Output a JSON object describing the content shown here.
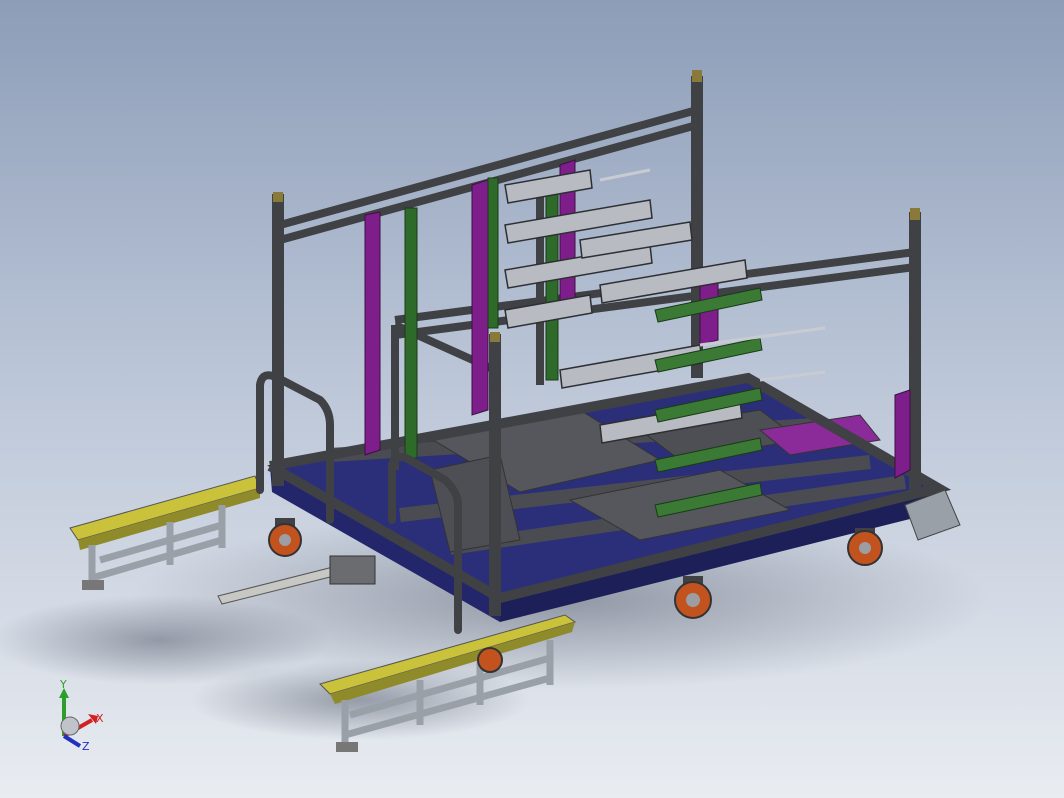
{
  "viewport": {
    "background_top": "#8d9db8",
    "background_bottom": "#e9ecf1"
  },
  "model": {
    "frame_color": "#3f4145",
    "base_color": "#2b2f7a",
    "wheel_color": "#c2521e",
    "bracket_color": "#7e1e8a",
    "rail_color": "#2e6b2a",
    "fixture_color": "#b8bcc2",
    "ramp_top_color": "#c9c23a",
    "ramp_color": "#9aa0a8"
  },
  "triad": {
    "x_label": "X",
    "y_label": "Y",
    "z_label": "Z",
    "x_color": "#d42020",
    "y_color": "#2aa02a",
    "z_color": "#2030c0"
  }
}
